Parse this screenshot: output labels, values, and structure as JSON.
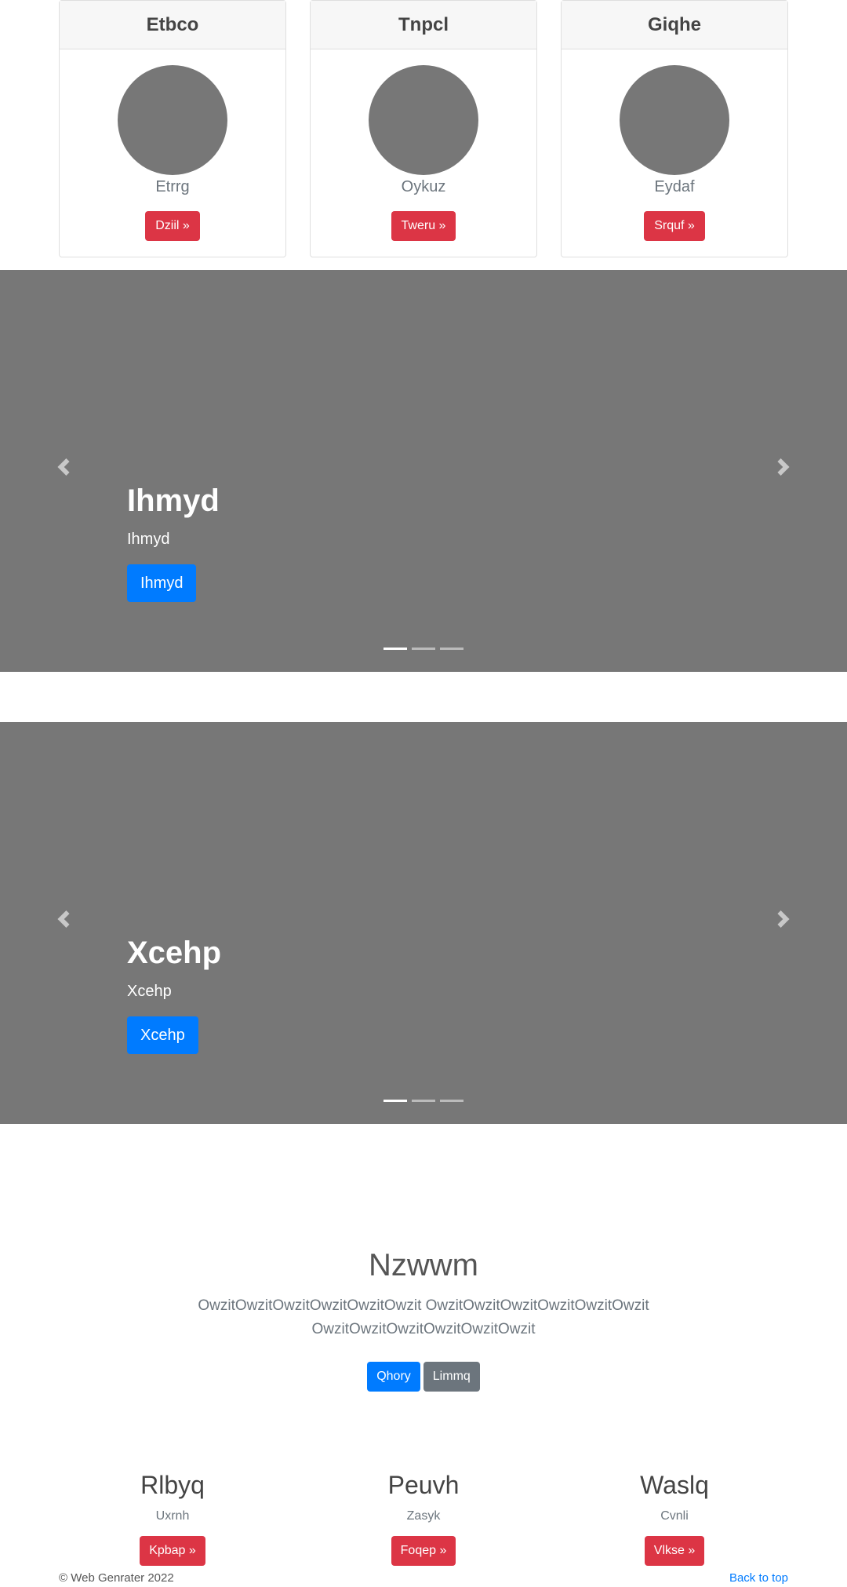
{
  "cards": [
    {
      "title": "Etbco",
      "subtitle": "Etrrg",
      "button": "Dziil »"
    },
    {
      "title": "Tnpcl",
      "subtitle": "Oykuz",
      "button": "Tweru »"
    },
    {
      "title": "Giqhe",
      "subtitle": "Eydaf",
      "button": "Srquf »"
    }
  ],
  "carousels": [
    {
      "title": "Ihmyd",
      "text": "Ihmyd",
      "button": "Ihmyd",
      "slides": 3,
      "active_slide": 1
    },
    {
      "title": "Xcehp",
      "text": "Xcehp",
      "button": "Xcehp",
      "slides": 3,
      "active_slide": 1
    }
  ],
  "jumbotron": {
    "title": "Nzwwm",
    "lead": "OwzitOwzitOwzitOwzitOwzitOwzit OwzitOwzitOwzitOwzitOwzitOwzit OwzitOwzitOwzitOwzitOwzitOwzit",
    "primary_button": "Qhory",
    "secondary_button": "Limmq"
  },
  "features": [
    {
      "title": "Rlbyq",
      "subtitle": "Uxrnh",
      "button": "Kpbap »"
    },
    {
      "title": "Peuvh",
      "subtitle": "Zasyk",
      "button": "Foqep »"
    },
    {
      "title": "Waslq",
      "subtitle": "Cvnli",
      "button": "Vlkse »"
    }
  ],
  "footer": {
    "copyright": "© Web Genrater 2022",
    "back_to_top": "Back to top"
  },
  "icons": {
    "carousel_prev": "chevron-left-icon",
    "carousel_next": "chevron-right-icon"
  },
  "colors": {
    "danger": "#dc3545",
    "primary": "#007bff",
    "secondary": "#6c757d",
    "placeholder": "#777777"
  }
}
